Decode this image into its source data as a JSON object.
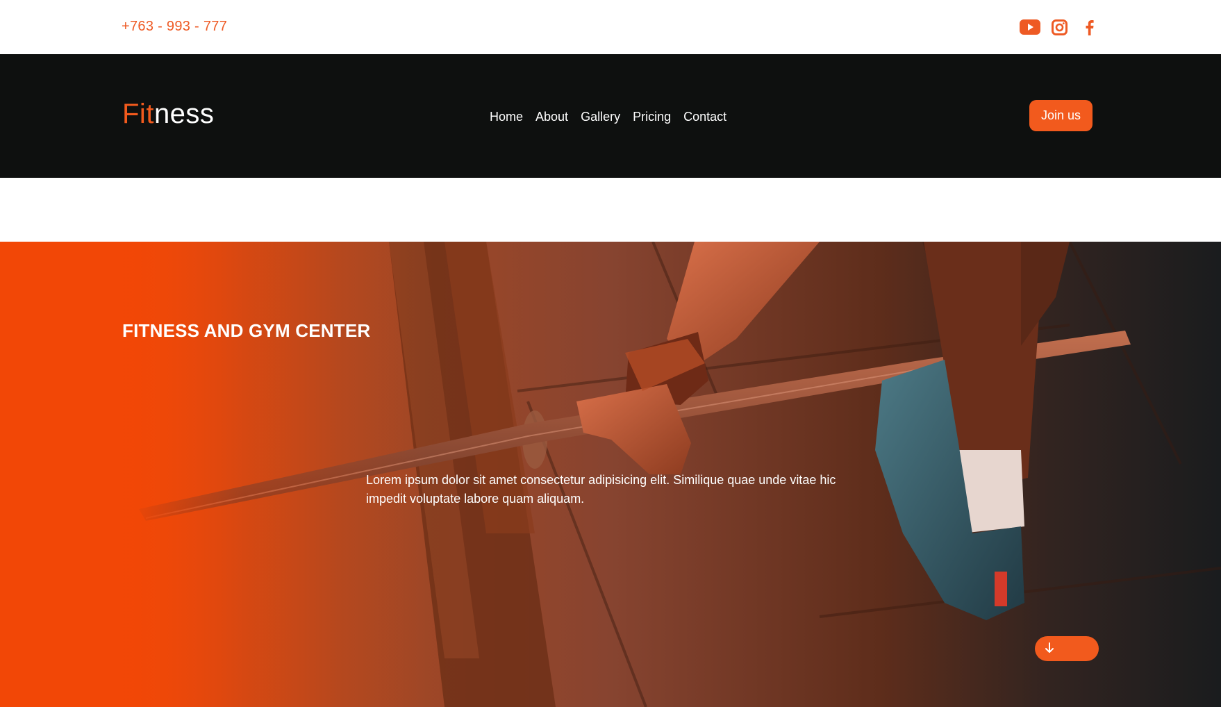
{
  "topbar": {
    "phone": "+763 - 993 - 777",
    "social": [
      {
        "name": "youtube-icon"
      },
      {
        "name": "instagram-icon"
      },
      {
        "name": "facebook-icon"
      }
    ]
  },
  "navbar": {
    "logo_accent": "Fit",
    "logo_rest": "ness",
    "menu": [
      "Home",
      "About",
      "Gallery",
      "Pricing",
      "Contact"
    ],
    "cta_label": "Join us"
  },
  "hero": {
    "title": "FITNESS AND GYM CENTER",
    "text": "Lorem ipsum dolor sit amet consectetur adipisicing elit. Similique quae unde vitae hic impedit voluptate labore quam aliquam.",
    "scroll_icon": "arrow-down-icon"
  },
  "colors": {
    "accent": "#f25a1d",
    "nav_bg": "#0e100f",
    "text_light": "#ffffff"
  }
}
